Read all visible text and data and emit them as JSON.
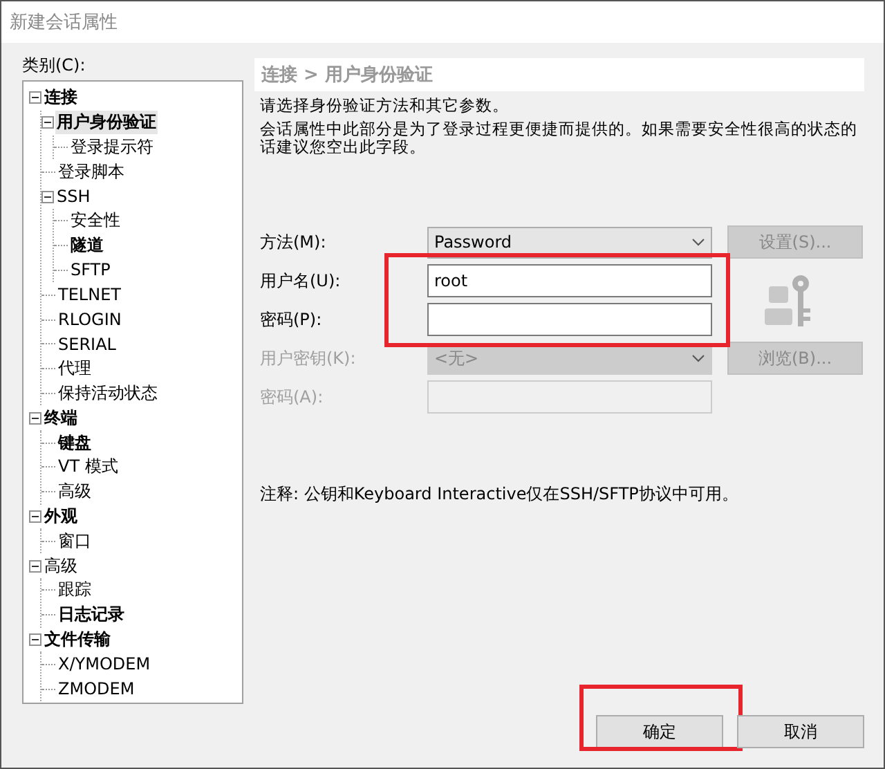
{
  "window": {
    "title": "新建会话属性"
  },
  "category_label": "类别(C):",
  "tree": [
    {
      "label": "连接",
      "bold": true,
      "selected": false,
      "expanded": true,
      "children": [
        {
          "label": "用户身份验证",
          "bold": true,
          "selected": true,
          "expanded": true,
          "children": [
            {
              "label": "登录提示符",
              "bold": false,
              "selected": false
            }
          ]
        },
        {
          "label": "登录脚本",
          "bold": false,
          "selected": false
        },
        {
          "label": "SSH",
          "bold": false,
          "selected": false,
          "expanded": true,
          "children": [
            {
              "label": "安全性",
              "bold": false,
              "selected": false
            },
            {
              "label": "隧道",
              "bold": true,
              "selected": false
            },
            {
              "label": "SFTP",
              "bold": false,
              "selected": false
            }
          ]
        },
        {
          "label": "TELNET",
          "bold": false,
          "selected": false
        },
        {
          "label": "RLOGIN",
          "bold": false,
          "selected": false
        },
        {
          "label": "SERIAL",
          "bold": false,
          "selected": false
        },
        {
          "label": "代理",
          "bold": false,
          "selected": false
        },
        {
          "label": "保持活动状态",
          "bold": false,
          "selected": false
        }
      ]
    },
    {
      "label": "终端",
      "bold": true,
      "selected": false,
      "expanded": true,
      "children": [
        {
          "label": "键盘",
          "bold": true,
          "selected": false
        },
        {
          "label": "VT 模式",
          "bold": false,
          "selected": false
        },
        {
          "label": "高级",
          "bold": false,
          "selected": false
        }
      ]
    },
    {
      "label": "外观",
      "bold": true,
      "selected": false,
      "expanded": true,
      "children": [
        {
          "label": "窗口",
          "bold": false,
          "selected": false
        }
      ]
    },
    {
      "label": "高级",
      "bold": false,
      "selected": false,
      "expanded": true,
      "children": [
        {
          "label": "跟踪",
          "bold": false,
          "selected": false
        },
        {
          "label": "日志记录",
          "bold": true,
          "selected": false
        }
      ]
    },
    {
      "label": "文件传输",
      "bold": true,
      "selected": false,
      "expanded": true,
      "children": [
        {
          "label": "X/YMODEM",
          "bold": false,
          "selected": false
        },
        {
          "label": "ZMODEM",
          "bold": false,
          "selected": false
        }
      ]
    }
  ],
  "panel": {
    "header": "连接 > 用户身份验证",
    "intro": "请选择身份验证方法和其它参数。",
    "description": "会话属性中此部分是为了登录过程更便捷而提供的。如果需要安全性很高的状态的话建议您空出此字段。",
    "method": {
      "label": "方法(M):",
      "value": "Password",
      "disabled": false
    },
    "settings_button": {
      "label": "设置(S)...",
      "disabled": true
    },
    "credentials": {
      "highlighted": true,
      "username": {
        "label": "用户名(U):",
        "value": "root"
      },
      "password": {
        "label": "密码(P):"
      }
    },
    "user_key": {
      "label": "用户密钥(K):",
      "value": "<无>",
      "disabled": true
    },
    "browse_button": {
      "label": "浏览(B)...",
      "disabled": true
    },
    "passphrase": {
      "label": "密码(A):",
      "disabled": true
    },
    "note": "注释: 公钥和Keyboard Interactive仅在SSH/SFTP协议中可用。"
  },
  "buttons": [
    {
      "label": "确定",
      "highlighted": true
    },
    {
      "label": "取消",
      "highlighted": false
    }
  ]
}
